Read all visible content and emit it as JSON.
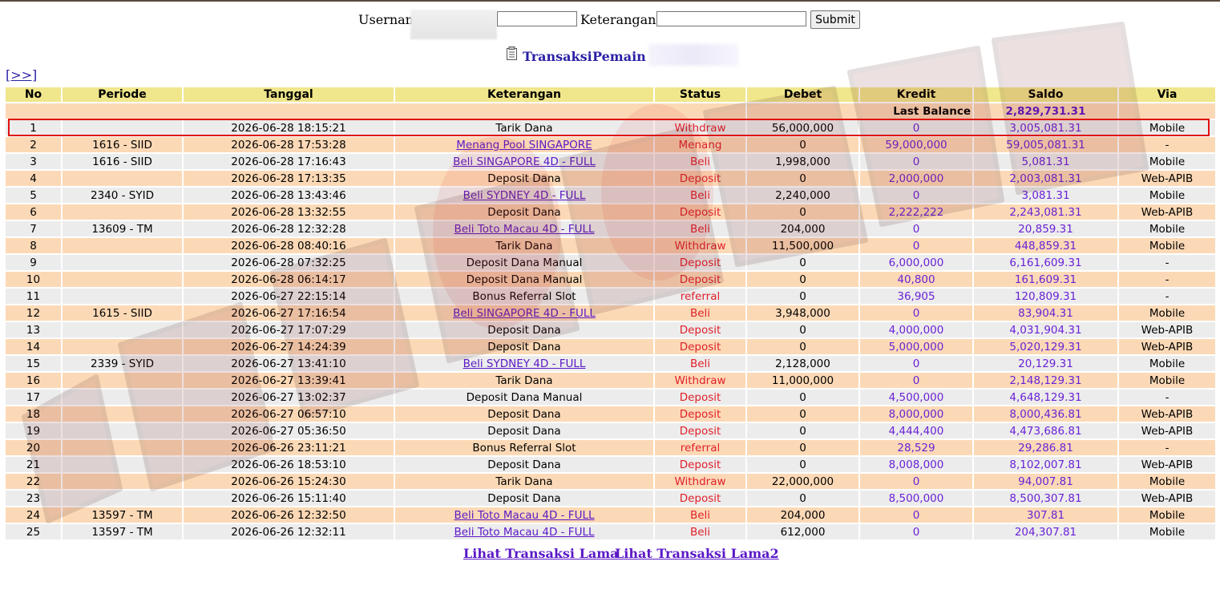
{
  "form": {
    "username_label": "Usernam",
    "username_value": "",
    "keterangan_label": "Keterangan :",
    "keterangan_value": "",
    "submit_label": "Submit"
  },
  "title": {
    "transaksi": "Transaksi",
    "pemain": "Pemain :"
  },
  "nav": {
    "next": "[>>]"
  },
  "columns": [
    "No",
    "Periode",
    "Tanggal",
    "Keterangan",
    "Status",
    "Debet",
    "Kredit",
    "Saldo",
    "Via"
  ],
  "last_balance": {
    "label": "Last Balance",
    "value": "2,829,731.31"
  },
  "rows": [
    {
      "no": "1",
      "periode": "",
      "tanggal": "2026-06-28 18:15:21",
      "keterangan": "Tarik Dana",
      "link": false,
      "status": "Withdraw",
      "debet": "56,000,000",
      "kredit": "0",
      "saldo": "3,005,081.31",
      "via": "Mobile"
    },
    {
      "no": "2",
      "periode": "1616 - SIID",
      "tanggal": "2026-06-28 17:53:28",
      "keterangan": "Menang Pool SINGAPORE",
      "link": true,
      "status": "Menang",
      "debet": "0",
      "kredit": "59,000,000",
      "saldo": "59,005,081.31",
      "via": "-"
    },
    {
      "no": "3",
      "periode": "1616 - SIID",
      "tanggal": "2026-06-28 17:16:43",
      "keterangan": "Beli SINGAPORE 4D - FULL",
      "link": true,
      "status": "Beli",
      "debet": "1,998,000",
      "kredit": "0",
      "saldo": "5,081.31",
      "via": "Mobile"
    },
    {
      "no": "4",
      "periode": "",
      "tanggal": "2026-06-28 17:13:35",
      "keterangan": "Deposit Dana",
      "link": false,
      "status": "Deposit",
      "debet": "0",
      "kredit": "2,000,000",
      "saldo": "2,003,081.31",
      "via": "Web-APIB"
    },
    {
      "no": "5",
      "periode": "2340 - SYID",
      "tanggal": "2026-06-28 13:43:46",
      "keterangan": "Beli SYDNEY 4D - FULL",
      "link": true,
      "status": "Beli",
      "debet": "2,240,000",
      "kredit": "0",
      "saldo": "3,081.31",
      "via": "Mobile"
    },
    {
      "no": "6",
      "periode": "",
      "tanggal": "2026-06-28 13:32:55",
      "keterangan": "Deposit Dana",
      "link": false,
      "status": "Deposit",
      "debet": "0",
      "kredit": "2,222,222",
      "saldo": "2,243,081.31",
      "via": "Web-APIB"
    },
    {
      "no": "7",
      "periode": "13609 - TM",
      "tanggal": "2026-06-28 12:32:28",
      "keterangan": "Beli Toto Macau 4D - FULL",
      "link": true,
      "status": "Beli",
      "debet": "204,000",
      "kredit": "0",
      "saldo": "20,859.31",
      "via": "Mobile"
    },
    {
      "no": "8",
      "periode": "",
      "tanggal": "2026-06-28 08:40:16",
      "keterangan": "Tarik Dana",
      "link": false,
      "status": "Withdraw",
      "debet": "11,500,000",
      "kredit": "0",
      "saldo": "448,859.31",
      "via": "Mobile"
    },
    {
      "no": "9",
      "periode": "",
      "tanggal": "2026-06-28 07:32:25",
      "keterangan": "Deposit Dana Manual",
      "link": false,
      "status": "Deposit",
      "debet": "0",
      "kredit": "6,000,000",
      "saldo": "6,161,609.31",
      "via": "-"
    },
    {
      "no": "10",
      "periode": "",
      "tanggal": "2026-06-28 06:14:17",
      "keterangan": "Deposit Dana Manual",
      "link": false,
      "status": "Deposit",
      "debet": "0",
      "kredit": "40,800",
      "saldo": "161,609.31",
      "via": "-"
    },
    {
      "no": "11",
      "periode": "",
      "tanggal": "2026-06-27 22:15:14",
      "keterangan": "Bonus Referral Slot",
      "link": false,
      "status": "referral",
      "debet": "0",
      "kredit": "36,905",
      "saldo": "120,809.31",
      "via": "-"
    },
    {
      "no": "12",
      "periode": "1615 - SIID",
      "tanggal": "2026-06-27 17:16:54",
      "keterangan": "Beli SINGAPORE 4D - FULL",
      "link": true,
      "status": "Beli",
      "debet": "3,948,000",
      "kredit": "0",
      "saldo": "83,904.31",
      "via": "Mobile"
    },
    {
      "no": "13",
      "periode": "",
      "tanggal": "2026-06-27 17:07:29",
      "keterangan": "Deposit Dana",
      "link": false,
      "status": "Deposit",
      "debet": "0",
      "kredit": "4,000,000",
      "saldo": "4,031,904.31",
      "via": "Web-APIB"
    },
    {
      "no": "14",
      "periode": "",
      "tanggal": "2026-06-27 14:24:39",
      "keterangan": "Deposit Dana",
      "link": false,
      "status": "Deposit",
      "debet": "0",
      "kredit": "5,000,000",
      "saldo": "5,020,129.31",
      "via": "Web-APIB"
    },
    {
      "no": "15",
      "periode": "2339 - SYID",
      "tanggal": "2026-06-27 13:41:10",
      "keterangan": "Beli SYDNEY 4D - FULL",
      "link": true,
      "status": "Beli",
      "debet": "2,128,000",
      "kredit": "0",
      "saldo": "20,129.31",
      "via": "Mobile"
    },
    {
      "no": "16",
      "periode": "",
      "tanggal": "2026-06-27 13:39:41",
      "keterangan": "Tarik Dana",
      "link": false,
      "status": "Withdraw",
      "debet": "11,000,000",
      "kredit": "0",
      "saldo": "2,148,129.31",
      "via": "Mobile"
    },
    {
      "no": "17",
      "periode": "",
      "tanggal": "2026-06-27 13:02:37",
      "keterangan": "Deposit Dana Manual",
      "link": false,
      "status": "Deposit",
      "debet": "0",
      "kredit": "4,500,000",
      "saldo": "4,648,129.31",
      "via": "-"
    },
    {
      "no": "18",
      "periode": "",
      "tanggal": "2026-06-27 06:57:10",
      "keterangan": "Deposit Dana",
      "link": false,
      "status": "Deposit",
      "debet": "0",
      "kredit": "8,000,000",
      "saldo": "8,000,436.81",
      "via": "Web-APIB"
    },
    {
      "no": "19",
      "periode": "",
      "tanggal": "2026-06-27 05:36:50",
      "keterangan": "Deposit Dana",
      "link": false,
      "status": "Deposit",
      "debet": "0",
      "kredit": "4,444,400",
      "saldo": "4,473,686.81",
      "via": "Web-APIB"
    },
    {
      "no": "20",
      "periode": "",
      "tanggal": "2026-06-26 23:11:21",
      "keterangan": "Bonus Referral Slot",
      "link": false,
      "status": "referral",
      "debet": "0",
      "kredit": "28,529",
      "saldo": "29,286.81",
      "via": "-"
    },
    {
      "no": "21",
      "periode": "",
      "tanggal": "2026-06-26 18:53:10",
      "keterangan": "Deposit Dana",
      "link": false,
      "status": "Deposit",
      "debet": "0",
      "kredit": "8,008,000",
      "saldo": "8,102,007.81",
      "via": "Web-APIB"
    },
    {
      "no": "22",
      "periode": "",
      "tanggal": "2026-06-26 15:24:30",
      "keterangan": "Tarik Dana",
      "link": false,
      "status": "Withdraw",
      "debet": "22,000,000",
      "kredit": "0",
      "saldo": "94,007.81",
      "via": "Mobile"
    },
    {
      "no": "23",
      "periode": "",
      "tanggal": "2026-06-26 15:11:40",
      "keterangan": "Deposit Dana",
      "link": false,
      "status": "Deposit",
      "debet": "0",
      "kredit": "8,500,000",
      "saldo": "8,500,307.81",
      "via": "Web-APIB"
    },
    {
      "no": "24",
      "periode": "13597 - TM",
      "tanggal": "2026-06-26 12:32:50",
      "keterangan": "Beli Toto Macau 4D - FULL",
      "link": true,
      "status": "Beli",
      "debet": "204,000",
      "kredit": "0",
      "saldo": "307.81",
      "via": "Mobile"
    },
    {
      "no": "25",
      "periode": "13597 - TM",
      "tanggal": "2026-06-26 12:32:11",
      "keterangan": "Beli Toto Macau 4D - FULL",
      "link": true,
      "status": "Beli",
      "debet": "612,000",
      "kredit": "0",
      "saldo": "204,307.81",
      "via": "Mobile"
    }
  ],
  "footer": {
    "link1": "Lihat Transaksi Lama",
    "link2": "Lihat Transaksi Lama2"
  },
  "colors": {
    "header_bg": "#f0e68c",
    "row_odd": "#ececec",
    "row_even": "#fcd9b6",
    "status": "#e0202a",
    "violet": "#6a22d6",
    "highlight": "#e01010"
  }
}
